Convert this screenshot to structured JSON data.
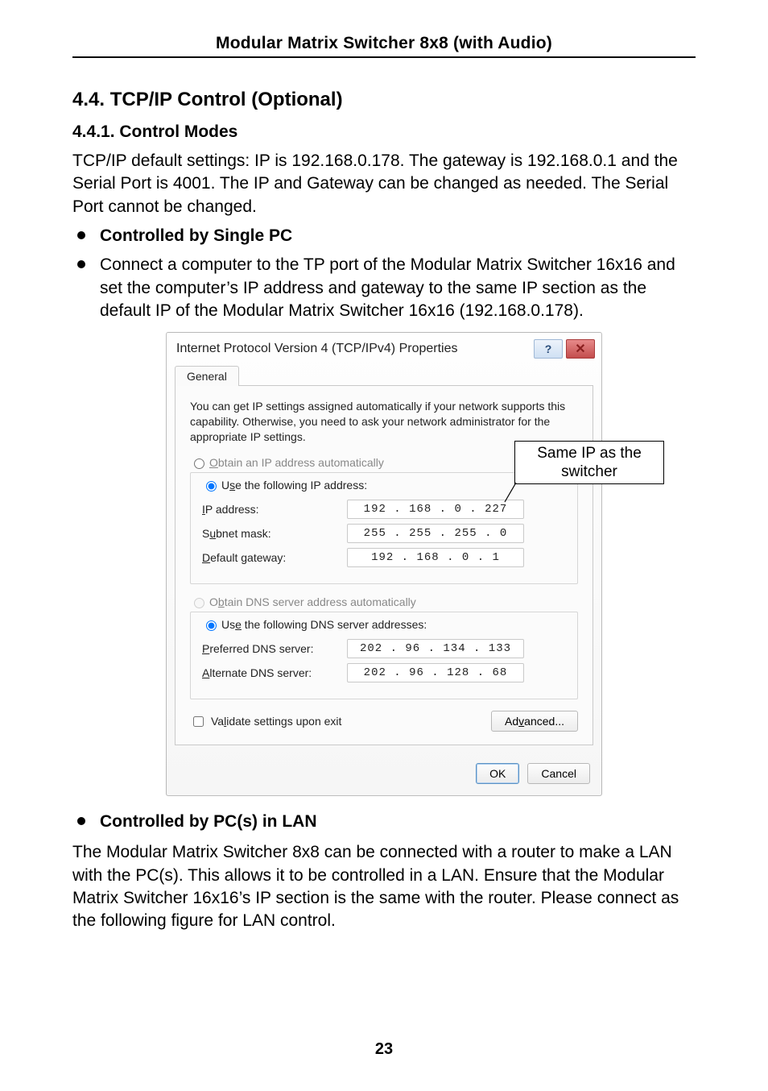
{
  "header": {
    "title": "Modular Matrix Switcher 8x8 (with Audio)"
  },
  "section": {
    "heading": "4.4. TCP/IP Control (Optional)",
    "sub_heading": "4.4.1. Control Modes",
    "intro": "TCP/IP default settings: IP is 192.168.0.178. The gateway is 192.168.0.1 and the Serial Port is 4001. The IP and Gateway can be changed as needed. The Serial Port cannot be changed.",
    "bullet1_title": "Controlled by Single PC",
    "bullet1_body": "Connect a computer to the TP port of the Modular Matrix Switcher 16x16 and set the computer’s IP address and gateway to the same IP section as the default IP of the Modular Matrix Switcher 16x16 (192.168.0.178).",
    "bullet2_title": "Controlled by PC(s) in LAN",
    "lan_para": "The Modular Matrix Switcher 8x8 can be connected with a router to make a LAN with the PC(s). This allows it to be controlled in a LAN. Ensure that the Modular Matrix Switcher 16x16’s IP section is the same with the router. Please connect as the following figure for LAN control."
  },
  "callout": {
    "text": "Same IP as the switcher"
  },
  "dialog": {
    "title": "Internet Protocol Version 4 (TCP/IPv4) Properties",
    "help_glyph": "?",
    "close_glyph": "✕",
    "tab": "General",
    "desc": "You can get IP settings assigned automatically if your network supports this capability. Otherwise, you need to ask your network administrator for the appropriate IP settings.",
    "radio_obtain_ip": "Obtain an IP address automatically",
    "radio_use_ip": "Use the following IP address:",
    "ip_label": "IP address:",
    "ip_value": "192 . 168 .  0  . 227",
    "subnet_label": "Subnet mask:",
    "subnet_value": "255 . 255 . 255 .  0",
    "gateway_label": "Default gateway:",
    "gateway_value": "192 . 168 .  0  .  1",
    "radio_obtain_dns": "Obtain DNS server address automatically",
    "radio_use_dns": "Use the following DNS server addresses:",
    "pref_dns_label": "Preferred DNS server:",
    "pref_dns_value": "202 .  96 . 134 . 133",
    "alt_dns_label": "Alternate DNS server:",
    "alt_dns_value": "202 .  96 . 128 .  68",
    "validate_label": "Validate settings upon exit",
    "advanced_btn": "Advanced...",
    "ok_btn": "OK",
    "cancel_btn": "Cancel"
  },
  "page_num": "23"
}
